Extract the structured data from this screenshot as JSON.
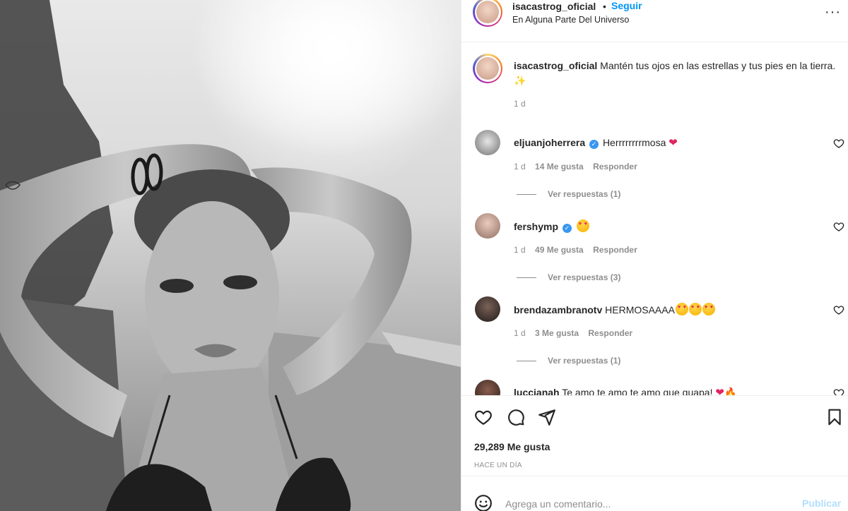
{
  "post": {
    "author": "isacastrog_oficial",
    "follow_label": "Seguir",
    "separator": "•",
    "location": "En Alguna Parte Del Universo",
    "more_label": "···"
  },
  "caption": {
    "author": "isacastrog_oficial",
    "text": "Mantén tus ojos en las estrellas y tus pies en la tierra.",
    "emoji": "✨",
    "time": "1 d"
  },
  "comments": [
    {
      "user": "eljuanjoherrera",
      "verified": true,
      "text": "Herrrrrrrrmosa",
      "time": "1 d",
      "likes": "14 Me gusta",
      "reply_label": "Responder",
      "replies_label": "Ver respuestas (1)"
    },
    {
      "user": "fershymp",
      "verified": true,
      "text": "",
      "time": "1 d",
      "likes": "49 Me gusta",
      "reply_label": "Responder",
      "replies_label": "Ver respuestas (3)"
    },
    {
      "user": "brendazambranotv",
      "verified": false,
      "text": "HERMOSAAAA",
      "time": "1 d",
      "likes": "3 Me gusta",
      "reply_label": "Responder",
      "replies_label": "Ver respuestas (1)"
    },
    {
      "user": "luccianah",
      "verified": false,
      "text": "Te amo te amo te amo que guapa!"
    }
  ],
  "verified_glyph": "✓",
  "actions": {
    "likes_count": "29,289 Me gusta",
    "posted_ago": "HACE UN DÍA"
  },
  "composer": {
    "placeholder": "Agrega un comentario...",
    "post_label": "Publicar"
  },
  "icons": [
    "more-icon",
    "heart-icon",
    "comment-icon",
    "share-icon",
    "bookmark-icon",
    "smile-icon",
    "verified-icon"
  ],
  "colors": {
    "link": "#0095f6",
    "post_disabled": "#b2dffc",
    "verified": "#3897f0",
    "muted": "#8e8e8e"
  }
}
